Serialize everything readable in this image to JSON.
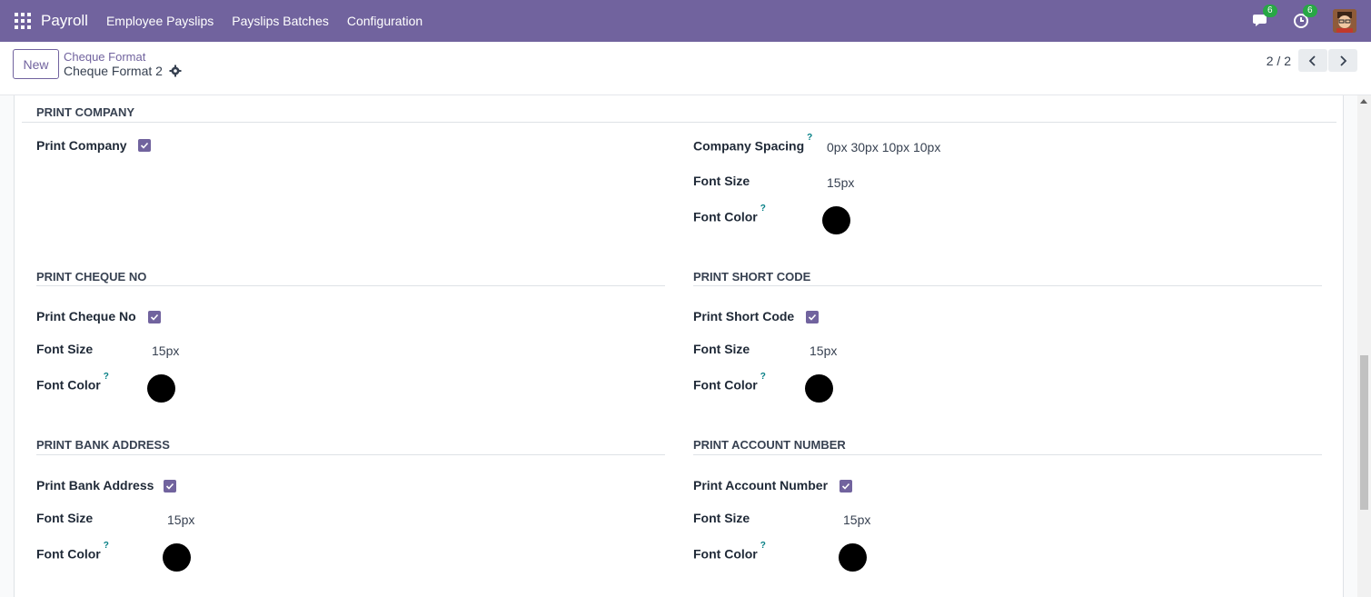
{
  "navbar": {
    "app_name": "Payroll",
    "menu": [
      "Employee Payslips",
      "Payslips Batches",
      "Configuration"
    ],
    "messages_count": "6",
    "activities_count": "6",
    "color": "#71639e"
  },
  "control": {
    "new_label": "New",
    "breadcrumb_parent": "Cheque Format",
    "breadcrumb_current": "Cheque Format 2",
    "pager": "2 / 2"
  },
  "sections": {
    "print_company": {
      "title": "PRINT COMPANY",
      "print_company_label": "Print Company",
      "print_company_checked": true,
      "company_spacing_label": "Company Spacing",
      "company_spacing_value": "0px 30px 10px 10px",
      "font_size_label": "Font Size",
      "font_size_value": "15px",
      "font_color_label": "Font Color",
      "font_color_value": "#000000"
    },
    "print_cheque_no": {
      "title": "PRINT CHEQUE NO",
      "toggle_label": "Print Cheque No",
      "toggle_checked": true,
      "font_size_label": "Font Size",
      "font_size_value": "15px",
      "font_color_label": "Font Color",
      "font_color_value": "#000000"
    },
    "print_short_code": {
      "title": "PRINT SHORT CODE",
      "toggle_label": "Print Short Code",
      "toggle_checked": true,
      "font_size_label": "Font Size",
      "font_size_value": "15px",
      "font_color_label": "Font Color",
      "font_color_value": "#000000"
    },
    "print_bank_address": {
      "title": "PRINT BANK ADDRESS",
      "toggle_label": "Print Bank Address",
      "toggle_checked": true,
      "font_size_label": "Font Size",
      "font_size_value": "15px",
      "font_color_label": "Font Color",
      "font_color_value": "#000000"
    },
    "print_account_number": {
      "title": "PRINT ACCOUNT NUMBER",
      "toggle_label": "Print Account Number",
      "toggle_checked": true,
      "font_size_label": "Font Size",
      "font_size_value": "15px",
      "font_color_label": "Font Color",
      "font_color_value": "#000000"
    }
  },
  "help_marker": "?"
}
